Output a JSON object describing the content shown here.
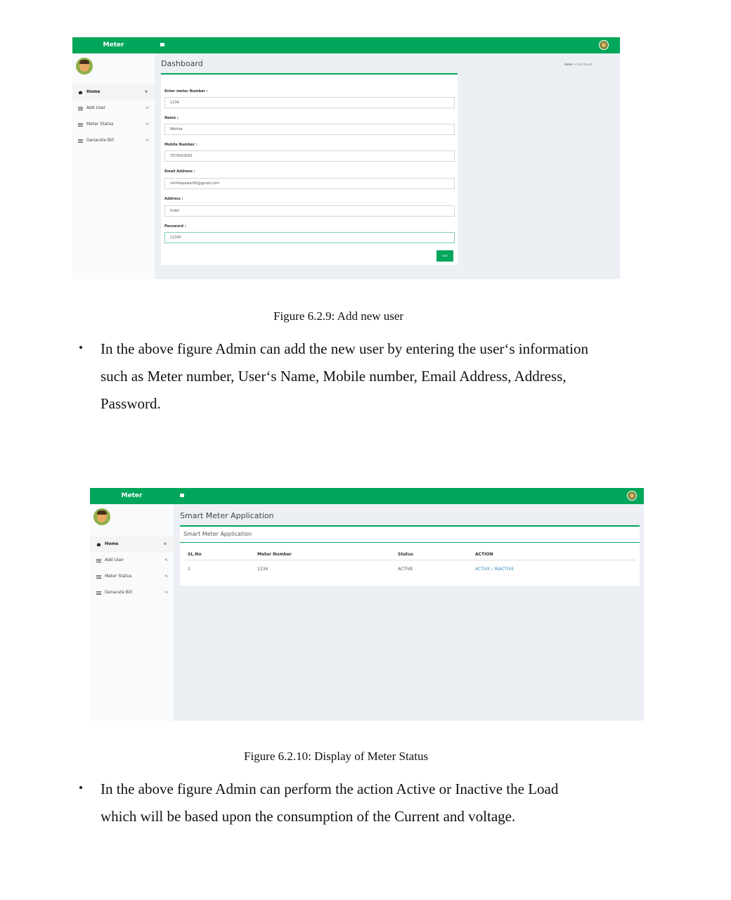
{
  "figure1": {
    "brand": "Meter",
    "page_title": "Dashboard",
    "breadcrumb": {
      "home": "Home",
      "separator": ">",
      "current": "Dashboard"
    },
    "sidebar": [
      {
        "label": "Home",
        "icon": "home-icon",
        "chevron": "v"
      },
      {
        "label": "Add User",
        "icon": "list-icon",
        "chevron": "<"
      },
      {
        "label": "Meter Status",
        "icon": "list-icon",
        "chevron": "<"
      },
      {
        "label": "Genarate Bill",
        "icon": "list-icon",
        "chevron": "<"
      }
    ],
    "form": {
      "meter_label": "Enter meter Number :",
      "meter_value": "1234",
      "name_label": "Name :",
      "name_value": "Nikhita",
      "mobile_label": "Mobile Number :",
      "mobile_value": "7676503091",
      "email_label": "Email Address :",
      "email_value": "nikhitapawar65@gmail.com",
      "address_label": "Address :",
      "address_value": "Hubli",
      "password_label": "Password :",
      "password_value": "12345",
      "add_button": "ADD"
    },
    "caption": "Figure 6.2.9: Add new user"
  },
  "paragraph1": {
    "bullet": "•",
    "lines": [
      "In the above figure Admin can add the new user by entering the user‘s information",
      "such as Meter number, User‘s Name, Mobile number, Email Address, Address,",
      "Password."
    ]
  },
  "figure2": {
    "brand": "Meter",
    "page_title": "Smart Meter Application",
    "box_title": "Smart Meter Application",
    "sidebar": [
      {
        "label": "Home",
        "icon": "home-icon",
        "chevron": "v"
      },
      {
        "label": "Add User",
        "icon": "list-icon",
        "chevron": "<"
      },
      {
        "label": "Meter Status",
        "icon": "list-icon",
        "chevron": "<"
      },
      {
        "label": "Genarate Bill",
        "icon": "list-icon",
        "chevron": "<"
      }
    ],
    "table": {
      "headers": [
        "SL.No",
        "Meter Number",
        "Status",
        "ACTION"
      ],
      "row": {
        "sl": "1",
        "meter": "1234",
        "status": "ACTIVE",
        "action": "ACTIVE / INACTIVE"
      }
    },
    "caption": "Figure 6.2.10: Display of Meter Status"
  },
  "paragraph2": {
    "bullet": "•",
    "lines": [
      "In the above figure Admin can perform the action Active or Inactive the Load",
      "which will be based upon the consumption of the Current and voltage."
    ]
  },
  "colors": {
    "accent": "#00a65a",
    "link": "#3c8dbc",
    "content_bg": "#ecf0f5"
  }
}
